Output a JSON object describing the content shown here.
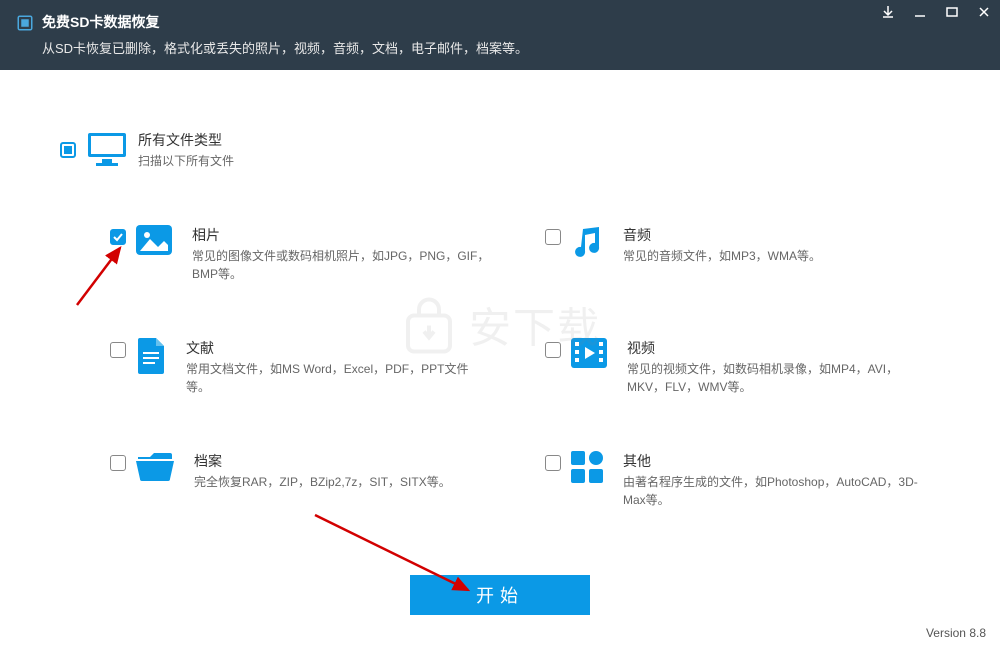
{
  "titlebar": {
    "title": "免费SD卡数据恢复",
    "subtitle": "从SD卡恢复已删除，格式化或丢失的照片，视频，音频，文档，电子邮件，档案等。"
  },
  "all_types": {
    "title": "所有文件类型",
    "desc": "扫描以下所有文件"
  },
  "types": {
    "photo": {
      "title": "相片",
      "desc": "常见的图像文件或数码相机照片，如JPG，PNG，GIF，BMP等。"
    },
    "audio": {
      "title": "音频",
      "desc": "常见的音频文件，如MP3，WMA等。"
    },
    "document": {
      "title": "文献",
      "desc": "常用文档文件，如MS Word，Excel，PDF，PPT文件等。"
    },
    "video": {
      "title": "视频",
      "desc": "常见的视频文件，如数码相机录像，如MP4，AVI，MKV，FLV，WMV等。"
    },
    "archive": {
      "title": "档案",
      "desc": "完全恢复RAR，ZIP，BZip2,7z，SIT，SITX等。"
    },
    "other": {
      "title": "其他",
      "desc": "由著名程序生成的文件，如Photoshop，AutoCAD，3D-Max等。"
    }
  },
  "start_button": "开始",
  "version": "Version 8.8",
  "watermark": "安下载",
  "colors": {
    "accent": "#0b99e6",
    "header": "#2e3d4a"
  }
}
